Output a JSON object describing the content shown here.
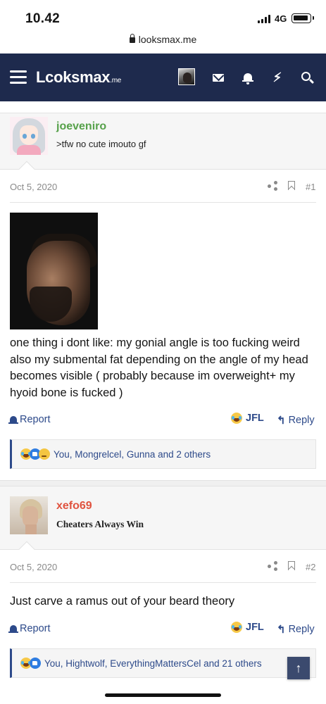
{
  "status_bar": {
    "time": "10.42",
    "network": "4G"
  },
  "browser": {
    "url": "looksmax.me"
  },
  "header": {
    "logo_main": "Lcoksmax",
    "logo_suffix": ".me"
  },
  "posts": [
    {
      "username": "joeveniro",
      "username_color": "#56a14a",
      "user_title": ">tfw no cute imouto gf",
      "date": "Oct 5, 2020",
      "post_number": "#1",
      "body_text": "one thing i dont like: my gonial angle is too fucking weird also my submental fat depending on the angle of my head becomes visible ( probably because im overweight+ my hyoid bone is fucked )",
      "report_label": "Report",
      "reaction_label": "JFL",
      "reply_label": "Reply",
      "reactions_summary": "You, Mongrelcel, Gunna and 2 others",
      "reaction_icons": [
        "laughing-emoji",
        "like-emoji",
        "hmm-emoji"
      ]
    },
    {
      "username": "xefo69",
      "username_color": "#e0533f",
      "user_title": "Cheaters Always Win",
      "date": "Oct 5, 2020",
      "post_number": "#2",
      "body_text": "Just carve a ramus out of your beard theory",
      "report_label": "Report",
      "reaction_label": "JFL",
      "reply_label": "Reply",
      "reactions_summary": "You, Hightwolf, EverythingMattersCel and 21 others",
      "reaction_icons": [
        "laughing-emoji",
        "like-emoji"
      ]
    }
  ],
  "scroll_top": {
    "icon": "↑"
  },
  "colors": {
    "header_bg": "#1e2a4d",
    "link": "#2d4a8a",
    "muted": "#8a8a8a"
  }
}
